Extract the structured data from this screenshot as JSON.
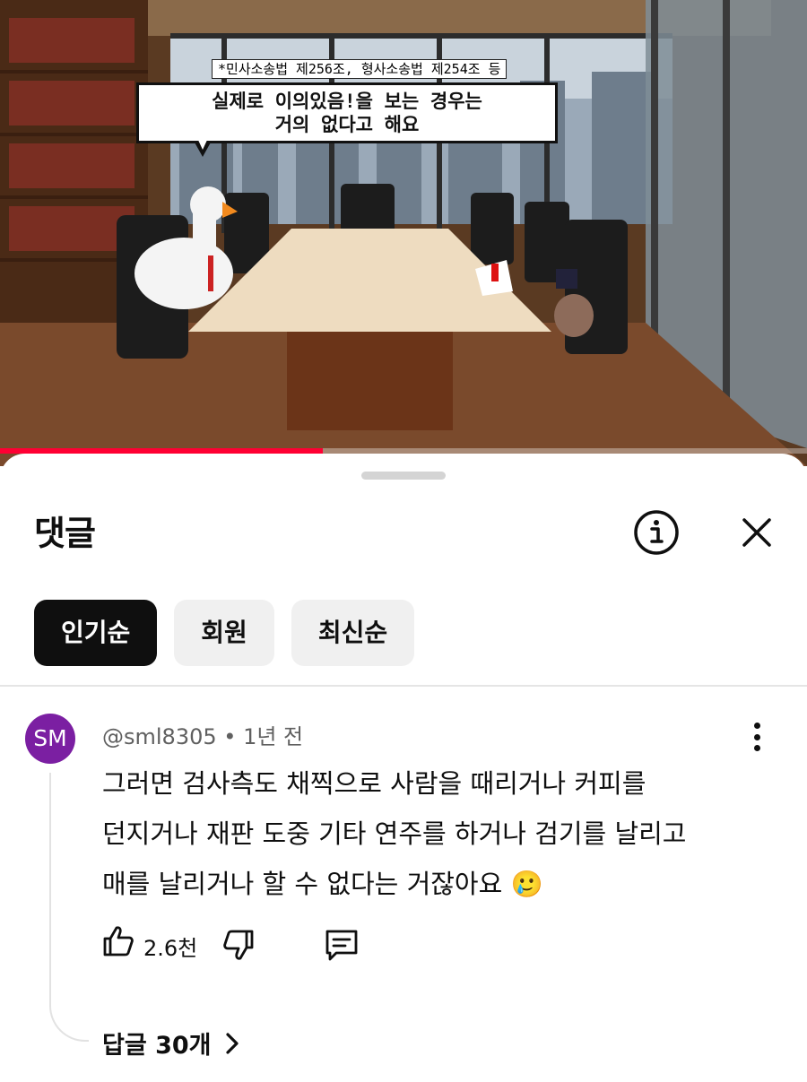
{
  "video": {
    "source_note": "*민사소송법 제256조, 형사소송법 제254조 등",
    "speech_line1": "실제로 이의있음!을 보는 경우는",
    "speech_line2": "거의 없다고 해요",
    "progress_percent": 40,
    "accent_color": "#ff0033"
  },
  "sheet": {
    "title": "댓글",
    "info_icon": "info-icon",
    "close_icon": "close-icon"
  },
  "chips": [
    {
      "label": "인기순",
      "active": true
    },
    {
      "label": "회원",
      "active": false
    },
    {
      "label": "최신순",
      "active": false
    }
  ],
  "comment": {
    "avatar_initials": "SM",
    "avatar_color": "#7b1fa2",
    "author": "@sml8305",
    "separator": "•",
    "time": "1년 전",
    "lines": [
      "그러면 검사측도 채찍으로 사람을 때리거나 커피를",
      "던지거나 재판 도중 기타 연주를 하거나 검기를 날리고",
      "매를 날리거나 할 수 없다는 거잖아요 🥲"
    ],
    "like_count": "2.6천",
    "replies_label": "답글 30개"
  }
}
